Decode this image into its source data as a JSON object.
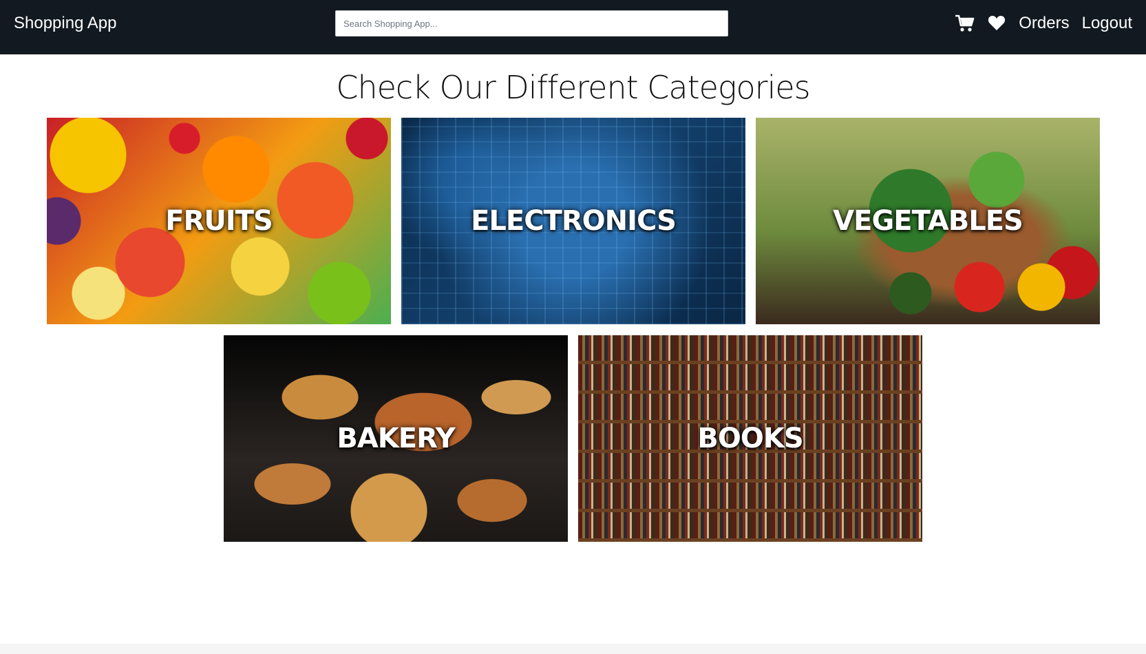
{
  "navbar": {
    "brand": "Shopping App",
    "search_placeholder": "Search Shopping App...",
    "search_value": "",
    "cart_icon": "cart-icon",
    "wishlist_icon": "heart-icon",
    "orders_label": "Orders",
    "logout_label": "Logout"
  },
  "main": {
    "heading": "Check Our Different Categories",
    "categories": [
      {
        "label": "FRUITS",
        "image": "fruits-photo"
      },
      {
        "label": "ELECTRONICS",
        "image": "circuit-board-photo"
      },
      {
        "label": "VEGETABLES",
        "image": "vegetable-basket-photo"
      },
      {
        "label": "BAKERY",
        "image": "pastries-photo"
      },
      {
        "label": "BOOKS",
        "image": "bookshelf-photo"
      }
    ]
  },
  "colors": {
    "navbar_bg": "#131921",
    "navbar_text": "#ffffff",
    "page_bg": "#ffffff"
  }
}
